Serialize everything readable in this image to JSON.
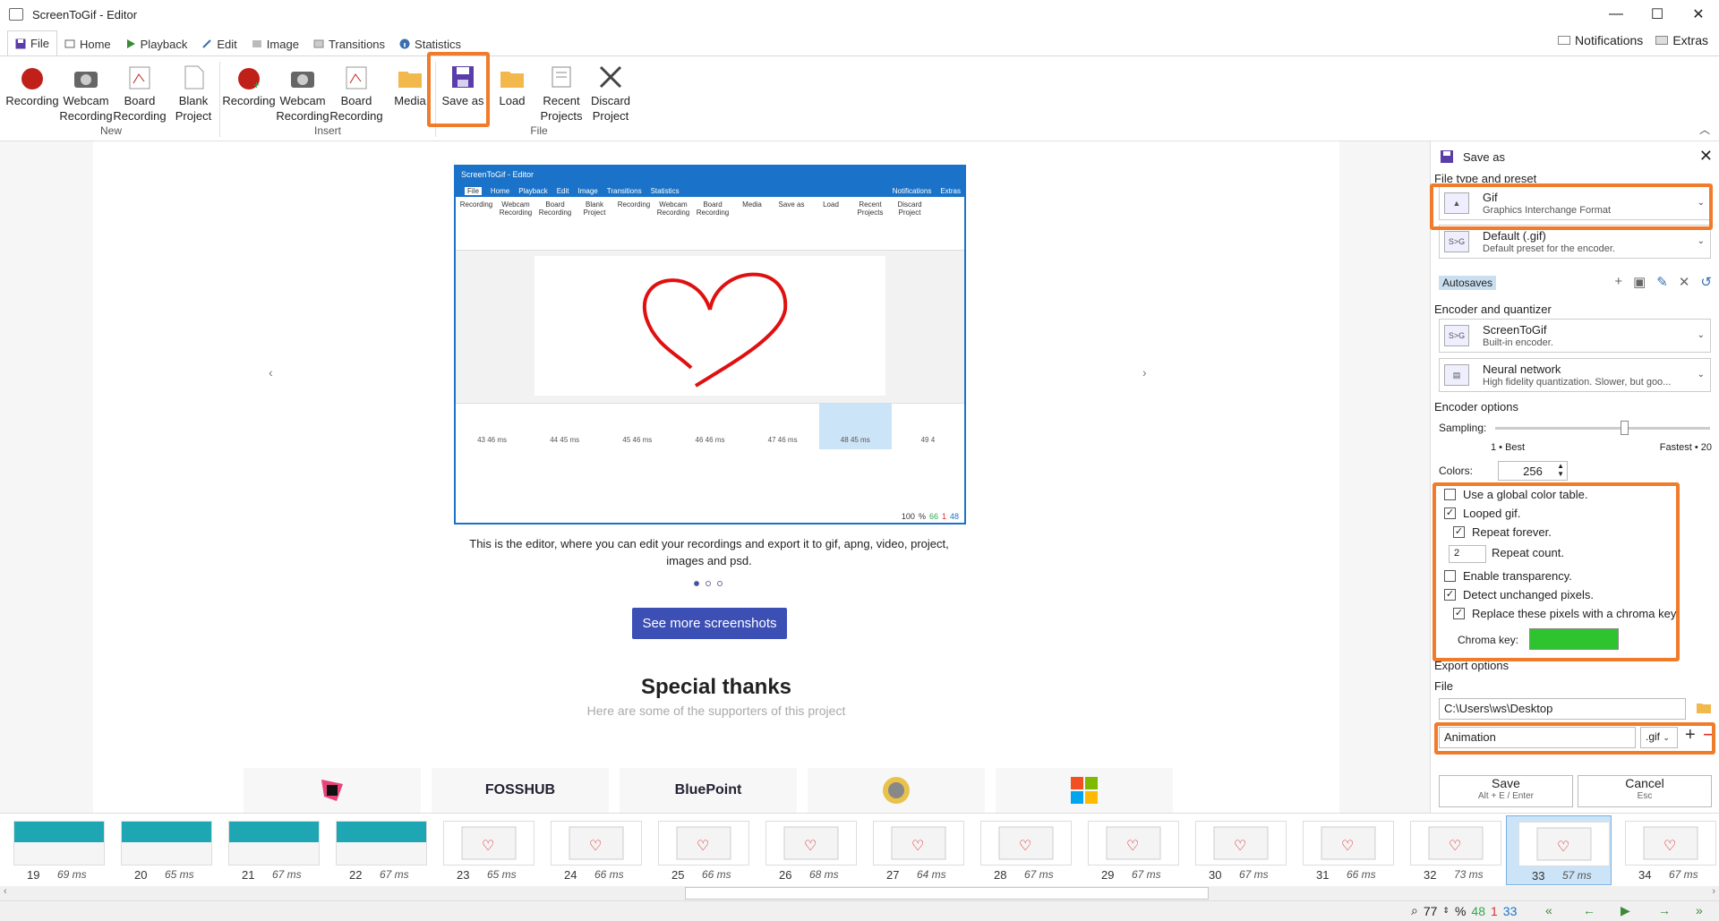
{
  "window": {
    "title": "ScreenToGif - Editor",
    "minimize": "—",
    "maximize": "☐",
    "close": "✕"
  },
  "tabs": [
    {
      "label": "File"
    },
    {
      "label": "Home"
    },
    {
      "label": "Playback"
    },
    {
      "label": "Edit"
    },
    {
      "label": "Image"
    },
    {
      "label": "Transitions"
    },
    {
      "label": "Statistics"
    }
  ],
  "tabright": {
    "notifications": "Notifications",
    "extras": "Extras"
  },
  "ribbon": {
    "groups": [
      {
        "label": "New",
        "buttons": [
          {
            "label": "Recording"
          },
          {
            "label": "Webcam Recording"
          },
          {
            "label": "Board Recording"
          },
          {
            "label": "Blank Project"
          }
        ]
      },
      {
        "label": "Insert",
        "buttons": [
          {
            "label": "Recording"
          },
          {
            "label": "Webcam Recording"
          },
          {
            "label": "Board Recording"
          },
          {
            "label": "Media"
          }
        ]
      },
      {
        "label": "File",
        "buttons": [
          {
            "label": "Save as"
          },
          {
            "label": "Load"
          },
          {
            "label": "Recent Projects"
          },
          {
            "label": "Discard Project"
          }
        ]
      }
    ]
  },
  "canvas": {
    "caption": "This is the editor, where you can edit your recordings and export it to gif, apng, video, project, images and psd.",
    "see_more": "See more screenshots",
    "thanks_title": "Special thanks",
    "thanks_sub": "Here are some of the supporters of this project",
    "sponsors": [
      "",
      "FOSSHUB",
      "BluePoint",
      "",
      ""
    ],
    "arrow_left": "‹",
    "arrow_right": "›",
    "inner": {
      "title": "ScreenToGif - Editor",
      "tabs": [
        "File",
        "Home",
        "Playback",
        "Edit",
        "Image",
        "Transitions",
        "Statistics"
      ],
      "tabright": [
        "Notifications",
        "Extras"
      ],
      "buttons": [
        "Recording",
        "Webcam Recording",
        "Board Recording",
        "Blank Project",
        "Recording",
        "Webcam Recording",
        "Board Recording",
        "Media",
        "Save as",
        "Load",
        "Recent Projects",
        "Discard Project"
      ],
      "groups": [
        "New",
        "Insert",
        "File"
      ],
      "frames": [
        {
          "num": "43",
          "ms": "46 ms"
        },
        {
          "num": "44",
          "ms": "45 ms"
        },
        {
          "num": "45",
          "ms": "46 ms"
        },
        {
          "num": "46",
          "ms": "46 ms"
        },
        {
          "num": "47",
          "ms": "46 ms"
        },
        {
          "num": "48",
          "ms": "45 ms"
        },
        {
          "num": "49",
          "ms": "4"
        }
      ],
      "status": {
        "zoom": "100",
        "pct": "%",
        "a": "66",
        "b": "1",
        "c": "48"
      }
    }
  },
  "panel": {
    "title": "Save as",
    "filetype_header": "File type and preset",
    "filetype": {
      "name": "Gif",
      "desc": "Graphics Interchange Format"
    },
    "preset": {
      "name": "Default (.gif)",
      "desc": "Default preset for the encoder."
    },
    "autosaves": "Autosaves",
    "encoder_header": "Encoder and quantizer",
    "encoder": {
      "name": "ScreenToGif",
      "desc": "Built-in encoder."
    },
    "quantizer": {
      "name": "Neural network",
      "desc": "High fidelity quantization. Slower, but goo..."
    },
    "encoder_opts_header": "Encoder options",
    "sampling_label": "Sampling:",
    "sampling_min": "1 • Best",
    "sampling_max": "Fastest • 20",
    "sampling_level": 0.6,
    "colors_label": "Colors:",
    "colors_value": "256",
    "options": [
      {
        "label": "Use a global color table.",
        "checked": false
      },
      {
        "label": "Looped gif.",
        "checked": true
      },
      {
        "label": "Repeat forever.",
        "checked": true
      },
      {
        "label": "Repeat count.",
        "value": "2"
      },
      {
        "label": "Enable transparency.",
        "checked": false
      },
      {
        "label": "Detect unchanged pixels.",
        "checked": true
      },
      {
        "label": "Replace these pixels with a chroma key.",
        "checked": true
      }
    ],
    "chroma_label": "Chroma key:",
    "chroma_color": "#2fc42f",
    "export_header": "Export options",
    "file_header": "File",
    "folder": "C:\\Users\\ws\\Desktop",
    "filename": "Animation",
    "extension": ".gif",
    "save": {
      "label": "Save",
      "shortcut": "Alt + E / Enter"
    },
    "cancel": {
      "label": "Cancel",
      "shortcut": "Esc"
    }
  },
  "filmstrip": [
    {
      "num": "19",
      "ms": "69 ms",
      "style": "teal"
    },
    {
      "num": "20",
      "ms": "65 ms",
      "style": "teal"
    },
    {
      "num": "21",
      "ms": "67 ms",
      "style": "teal"
    },
    {
      "num": "22",
      "ms": "67 ms",
      "style": "teal"
    },
    {
      "num": "23",
      "ms": "65 ms",
      "style": "heart"
    },
    {
      "num": "24",
      "ms": "66 ms",
      "style": "heart"
    },
    {
      "num": "25",
      "ms": "66 ms",
      "style": "heart"
    },
    {
      "num": "26",
      "ms": "68 ms",
      "style": "heart"
    },
    {
      "num": "27",
      "ms": "64 ms",
      "style": "heart"
    },
    {
      "num": "28",
      "ms": "67 ms",
      "style": "heart"
    },
    {
      "num": "29",
      "ms": "67 ms",
      "style": "heart"
    },
    {
      "num": "30",
      "ms": "67 ms",
      "style": "heart"
    },
    {
      "num": "31",
      "ms": "66 ms",
      "style": "heart"
    },
    {
      "num": "32",
      "ms": "73 ms",
      "style": "heart"
    },
    {
      "num": "33",
      "ms": "57 ms",
      "style": "heart",
      "selected": true
    },
    {
      "num": "34",
      "ms": "67 ms",
      "style": "heart"
    }
  ],
  "status": {
    "zoom": "77",
    "pct": "%",
    "total": "48",
    "selected": "1",
    "current": "33"
  },
  "colors": {
    "accent": "#f07b2a",
    "brand": "#1a73c8",
    "button": "#3b4fb5",
    "green": "#2fa84f",
    "red": "#d93025"
  }
}
